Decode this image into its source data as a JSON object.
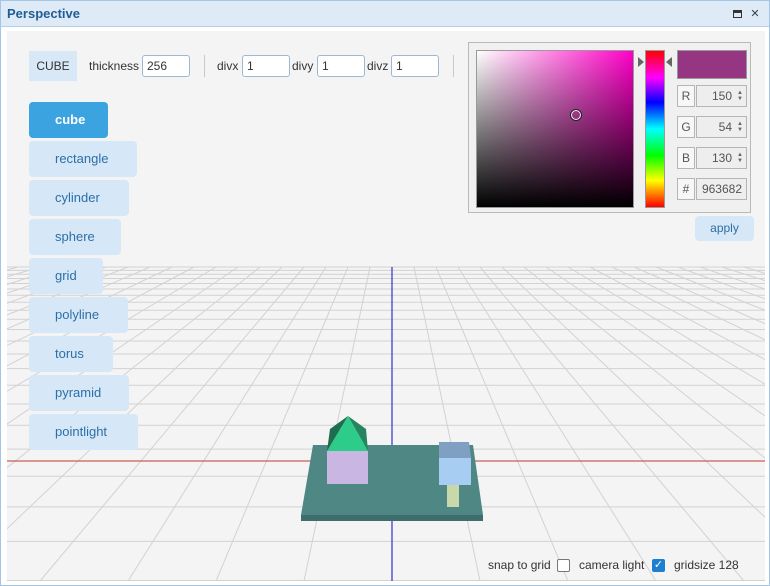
{
  "window": {
    "title": "Perspective"
  },
  "toolbar": {
    "shape_tag": "CUBE",
    "thickness_label": "thickness",
    "thickness_value": "256",
    "divx_label": "divx",
    "divx_value": "1",
    "divy_label": "divy",
    "divy_value": "1",
    "divz_label": "divz",
    "divz_value": "1"
  },
  "shapes": {
    "active": "cube",
    "items": [
      "cube",
      "rectangle",
      "cylinder",
      "sphere",
      "grid",
      "polyline",
      "torus",
      "pyramid",
      "pointlight"
    ]
  },
  "color_picker": {
    "r_key": "R",
    "r_value": "150",
    "g_key": "G",
    "g_value": "54",
    "b_key": "B",
    "b_value": "130",
    "hex_key": "#",
    "hex_value": "963682",
    "selected_color": "#963682",
    "apply_label": "apply"
  },
  "options": {
    "snap_label": "snap to grid",
    "snap_checked": false,
    "camera_light_label": "camera light",
    "camera_light_checked": true,
    "gridsize_label": "gridsize 128"
  },
  "icons": [
    "maximize-icon",
    "close-icon",
    "checkmark-icon"
  ],
  "colors": {
    "accent": "#3aa3e0",
    "button_bg": "#d6e8f7",
    "x_axis": "#c0392b",
    "z_axis": "#3232c8"
  }
}
